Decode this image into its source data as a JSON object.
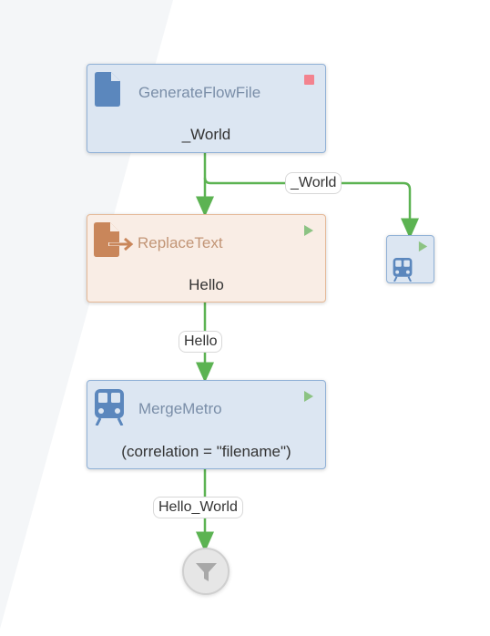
{
  "colors": {
    "edge": "#5cb352",
    "blue_node_bg": "#dce6f2",
    "orange_node_bg": "#f9ede5",
    "stop_indicator": "#f3838f",
    "run_indicator": "#8cc383",
    "sink_bg": "#e6e6e6"
  },
  "nodes": {
    "generate": {
      "title": "GenerateFlowFile",
      "subtitle": "_World",
      "icon": "file-icon",
      "status": "stopped"
    },
    "replace": {
      "title": "ReplaceText",
      "subtitle": "Hello",
      "icon": "file-export-icon",
      "status": "running"
    },
    "merge": {
      "title": "MergeMetro",
      "subtitle": "(correlation = \"filename\")",
      "icon": "metro-icon",
      "status": "running"
    },
    "small_metro": {
      "icon": "metro-icon",
      "status": "running"
    },
    "sink": {
      "icon": "funnel-icon"
    }
  },
  "edges": {
    "generate_to_metro": "_World",
    "replace_to_merge": "Hello",
    "merge_to_sink": "Hello_World"
  }
}
